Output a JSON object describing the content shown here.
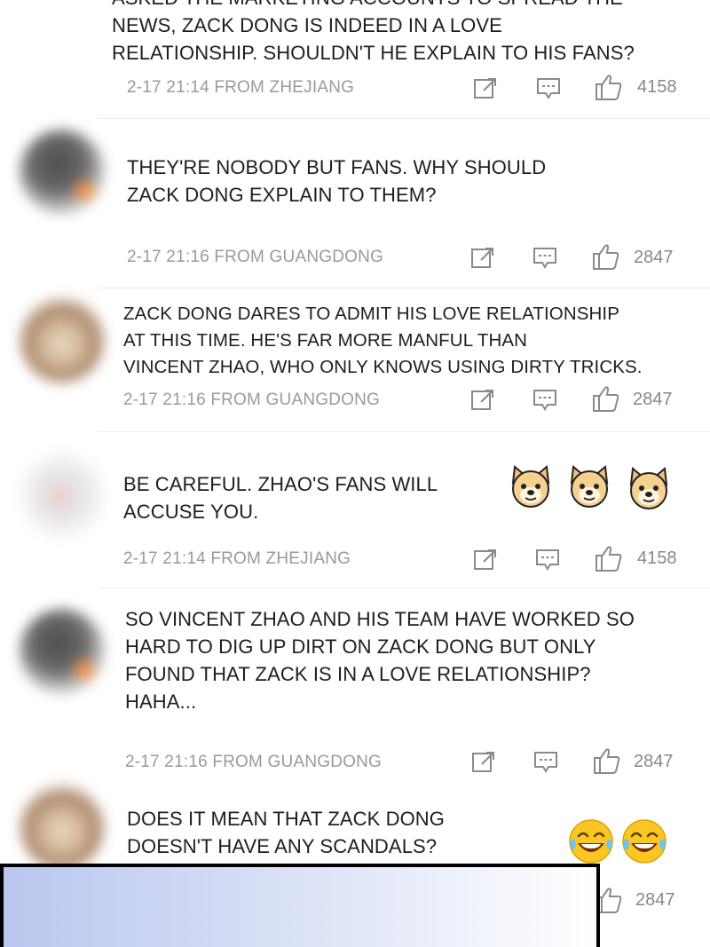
{
  "comments": [
    {
      "text": "NEWS, ZACK DONG IS INDEED IN A LOVE\nRELATIONSHIP. SHOULDN'T HE EXPLAIN TO HIS FANS?",
      "cut_text": "ASKED THE MARKETING ACCOUNTS TO SPREAD THE",
      "time": "2-17 21:14 FROM ZHEJIANG",
      "likes": "4158"
    },
    {
      "text": "THEY'RE NOBODY BUT FANS. WHY SHOULD\nZACK DONG EXPLAIN TO THEM?",
      "time": "2-17 21:16 FROM GUANGDONG",
      "likes": "2847"
    },
    {
      "text": "ZACK DONG DARES TO ADMIT HIS LOVE RELATIONSHIP\nAT THIS TIME. HE'S FAR MORE MANFUL THAN\nVINCENT ZHAO, WHO ONLY KNOWS USING DIRTY TRICKS.",
      "time": "2-17 21:16 FROM GUANGDONG",
      "likes": "2847"
    },
    {
      "text": "BE CAREFUL. ZHAO'S FANS WILL\nACCUSE YOU.",
      "time": "2-17 21:14 FROM ZHEJIANG",
      "likes": "4158"
    },
    {
      "text": "SO VINCENT ZHAO AND HIS TEAM HAVE WORKED SO\nHARD TO DIG UP DIRT ON ZACK DONG BUT ONLY\nFOUND THAT ZACK IS IN A LOVE RELATIONSHIP?\nHAHA...",
      "time": "2-17 21:16 FROM GUANGDONG",
      "likes": "2847"
    },
    {
      "text": "DOES IT MEAN THAT ZACK DONG\nDOESN'T HAVE ANY SCANDALS?",
      "time": "",
      "likes": "2847"
    }
  ],
  "icons": {
    "share": "share-icon",
    "comment": "comment-icon",
    "like": "thumbs-up-icon"
  },
  "colors": {
    "meta_text": "#9a9a9a",
    "body_text": "#1e1e1e",
    "overlay_gradient_start": "#b9c7ef"
  }
}
